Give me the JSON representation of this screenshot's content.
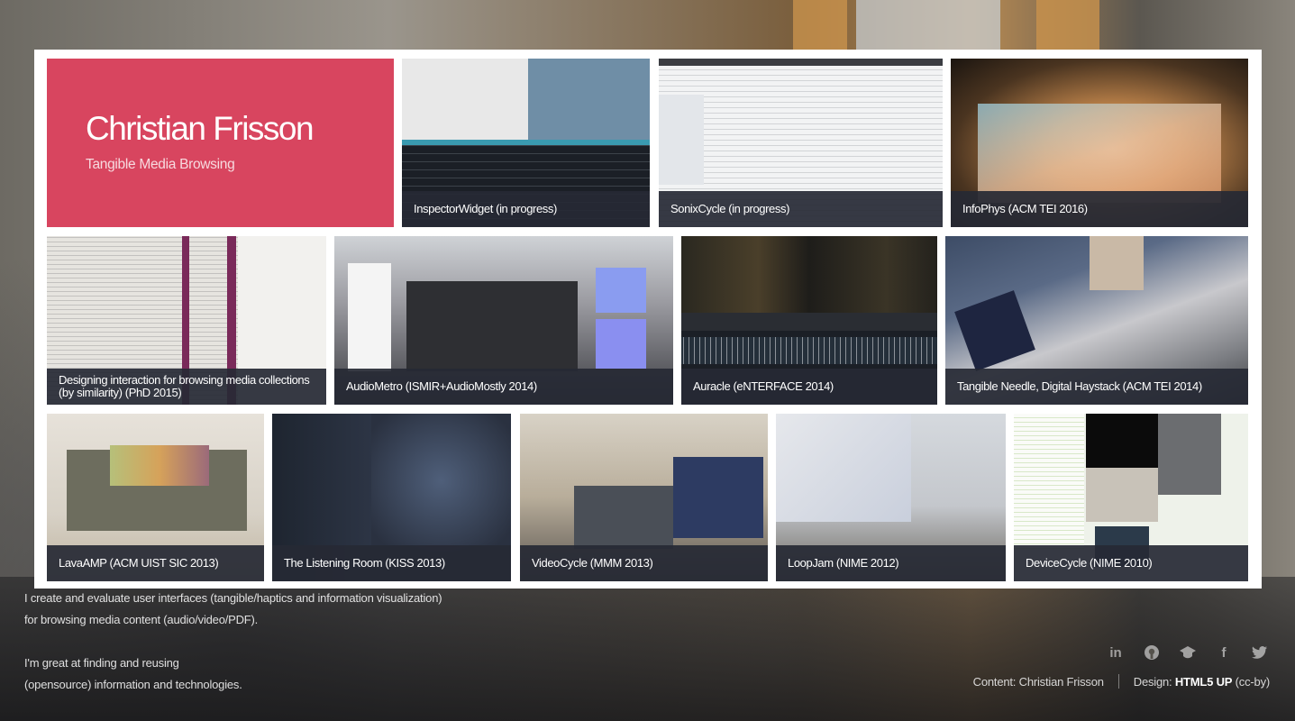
{
  "header": {
    "name": "Christian Frisson",
    "tagline": "Tangible Media Browsing"
  },
  "projects": [
    {
      "label": "InspectorWidget (in progress)"
    },
    {
      "label": "SonixCycle (in progress)"
    },
    {
      "label": "InfoPhys (ACM TEI 2016)"
    },
    {
      "label": "Designing interaction for browsing media collections (by similarity) (PhD 2015)"
    },
    {
      "label": "AudioMetro (ISMIR+AudioMostly 2014)"
    },
    {
      "label": "Auracle (eNTERFACE 2014)"
    },
    {
      "label": "Tangible Needle, Digital Haystack (ACM TEI 2014)"
    },
    {
      "label": "LavaAMP (ACM UIST SIC 2013)"
    },
    {
      "label": "The Listening Room (KISS 2013)"
    },
    {
      "label": "VideoCycle (MMM 2013)"
    },
    {
      "label": "LoopJam (NIME 2012)"
    },
    {
      "label": "DeviceCycle (NIME 2010)"
    }
  ],
  "bio": {
    "line1": "I create and evaluate user interfaces (tangible/haptics and information visualization)",
    "line2": "for browsing media content (audio/video/PDF).",
    "line3": "I'm great at finding and reusing",
    "line4": "(opensource) information and technologies."
  },
  "social": {
    "linkedin": "in",
    "github": "github-icon",
    "scholar": "graduation-cap-icon",
    "facebook": "f",
    "twitter": "twitter-icon"
  },
  "footer": {
    "content_label": "Content: Christian Frisson",
    "design_prefix": "Design: ",
    "design_name": "HTML5 UP",
    "design_license": " (cc-by)"
  },
  "colors": {
    "accent": "#d8455f",
    "caption_bg": "#262934"
  }
}
